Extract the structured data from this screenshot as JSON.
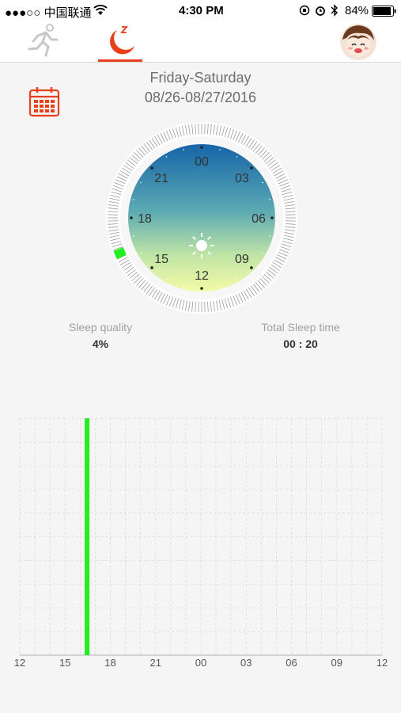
{
  "status": {
    "carrier": "●●●○○ 中国联通",
    "time": "4:30 PM",
    "battery": "84%"
  },
  "header": {
    "day_range": "Friday-Saturday",
    "date_range": "08/26-08/27/2016"
  },
  "dial": {
    "hour_labels": [
      "00",
      "03",
      "06",
      "09",
      "12",
      "15",
      "18",
      "21"
    ]
  },
  "stats": {
    "quality_label": "Sleep quality",
    "quality_value": "4%",
    "total_label": "Total Sleep time",
    "total_value": "00 : 20"
  },
  "chart_data": {
    "type": "bar",
    "x_ticks": [
      "12",
      "15",
      "18",
      "21",
      "00",
      "03",
      "06",
      "09",
      "12"
    ],
    "bars": [
      {
        "start_hour": 16.3,
        "end_hour": 16.6,
        "level": 1.0,
        "color": "#22ee22"
      }
    ],
    "grid": true
  },
  "colors": {
    "accent": "#e8401a",
    "sleep_green": "#22ee22",
    "dial_top": "#1664a8",
    "dial_bottom": "#f2fba6"
  }
}
